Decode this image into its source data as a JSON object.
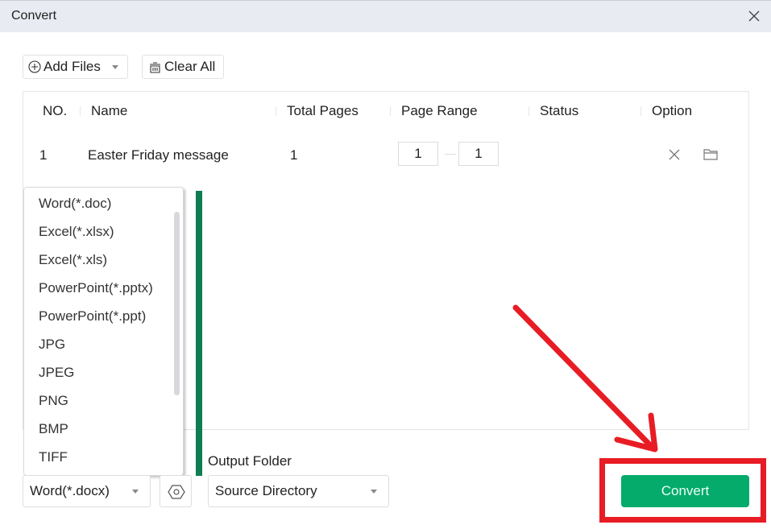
{
  "window": {
    "title": "Convert",
    "close_icon": "close-icon"
  },
  "toolbar": {
    "add_files_label": "Add Files",
    "add_files_icon": "plus-circle-icon",
    "clear_all_label": "Clear All",
    "clear_all_icon": "trash-icon"
  },
  "table": {
    "columns": [
      "NO.",
      "Name",
      "Total Pages",
      "Page Range",
      "Status",
      "Option"
    ],
    "rows": [
      {
        "no": "1",
        "name": "Easter Friday message",
        "total_pages": "1",
        "range_from": "1",
        "range_to": "1",
        "status": "",
        "option_icons": [
          "remove-icon",
          "folder-icon"
        ]
      }
    ]
  },
  "format_dropdown": {
    "options": [
      "Word(*.doc)",
      "Excel(*.xlsx)",
      "Excel(*.xls)",
      "PowerPoint(*.pptx)",
      "PowerPoint(*.ppt)",
      "JPG",
      "JPEG",
      "PNG",
      "BMP",
      "TIFF"
    ]
  },
  "bottom": {
    "format_selected": "Word(*.docx)",
    "settings_icon": "hexagon-settings-icon",
    "output_folder_label": "Output Folder",
    "output_folder_selected": "Source Directory",
    "convert_label": "Convert"
  },
  "colors": {
    "accent_green": "#04ab6b",
    "annotation_red": "#e81c24",
    "sidebar_bar_green": "#0e7d52"
  }
}
